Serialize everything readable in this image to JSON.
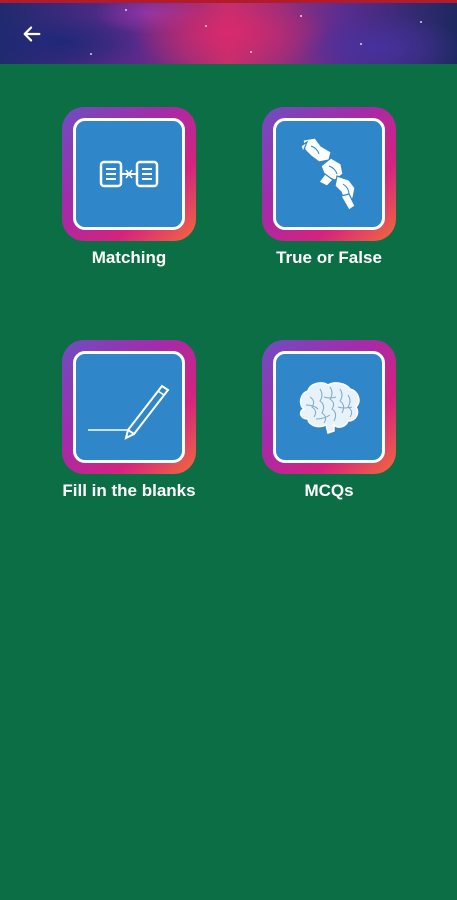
{
  "header": {
    "back_icon": "arrow-left-icon"
  },
  "tiles": [
    {
      "label": "Matching",
      "icon": "matching-icon"
    },
    {
      "label": "True or False",
      "icon": "true-false-icon"
    },
    {
      "label": "Fill in the blanks",
      "icon": "pencil-icon"
    },
    {
      "label": "MCQs",
      "icon": "brain-icon"
    }
  ],
  "colors": {
    "background": "#0b6e45",
    "tile_inner": "#2f86c8",
    "tile_gradient": [
      "#6d4fc0",
      "#a62aa8",
      "#d4237f",
      "#f26a3a"
    ],
    "text": "#ffffff"
  }
}
